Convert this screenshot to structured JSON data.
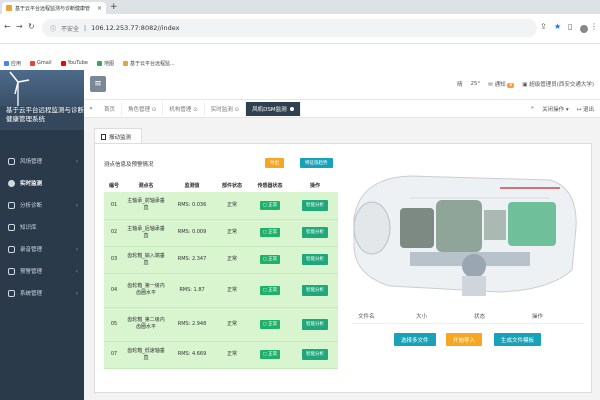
{
  "browser": {
    "tab_title": "基于云平台远程监测与诊断健康管",
    "new_tab": "+",
    "address_security": "不安全",
    "address_url": "106.12.253.77:8082//index",
    "bookmarks": [
      "应用",
      "Gmail",
      "YouTube",
      "地图",
      "基于云平台远程监..."
    ]
  },
  "sidebar": {
    "app_title": "基于云平台远程监测与诊断健康管理系统",
    "items": [
      {
        "label": "风场管理",
        "chev": "‹"
      },
      {
        "label": "实时监测",
        "chev": ""
      },
      {
        "label": "分析诊断",
        "chev": "‹"
      },
      {
        "label": "知识库",
        "chev": ""
      },
      {
        "label": "录音管理",
        "chev": "‹"
      },
      {
        "label": "预警管理",
        "chev": "‹"
      },
      {
        "label": "系统管理",
        "chev": "‹"
      }
    ]
  },
  "topbar": {
    "menu_icon": "≡",
    "weather": "晴",
    "temp": "25°",
    "notice": "通知",
    "notice_count": "8",
    "user": "超级管理员(西安交通大学)"
  },
  "tabs": {
    "items": [
      "首页",
      "角色管理 ⊙",
      "机构管理 ⊙",
      "实时监测 ⊙"
    ],
    "active": "风机DSM监测",
    "close_ops": "关闭操作 ▾",
    "exit": "退出"
  },
  "panel": {
    "tab": "振动监测",
    "table_title": "测点信息及预警情况",
    "btn_export": "导出",
    "btn_feature": "特征值趋势",
    "headers": [
      "编号",
      "测点名",
      "监测值",
      "部件状态",
      "传感器状态",
      "操作"
    ],
    "rows": [
      {
        "no": "01",
        "name": "主轴承_前轴承垂直",
        "value": "RMS: 0.036",
        "state": "正常",
        "sensor": "正常",
        "op": "智能分析"
      },
      {
        "no": "02",
        "name": "主轴承_后轴承垂直",
        "value": "RMS: 0.009",
        "state": "正常",
        "sensor": "正常",
        "op": "智能分析"
      },
      {
        "no": "03",
        "name": "齿轮箱_输入端垂直",
        "value": "RMS: 2.347",
        "state": "正常",
        "sensor": "正常",
        "op": "智能分析"
      },
      {
        "no": "04",
        "name": "齿轮箱_第一级内齿圈水平",
        "value": "RMS: 1.87",
        "state": "正常",
        "sensor": "正常",
        "op": "智能分析"
      },
      {
        "no": "05",
        "name": "齿轮箱_第二级内齿圈水平",
        "value": "RMS: 2.948",
        "state": "正常",
        "sensor": "正常",
        "op": "智能分析"
      },
      {
        "no": "07",
        "name": "齿轮箱_低速轴垂直",
        "value": "RMS: 4.669",
        "state": "正常",
        "sensor": "正常",
        "op": "智能分析"
      }
    ],
    "file_headers": [
      "文件名",
      "大小",
      "状态",
      "操作"
    ],
    "btn_select": "选择多文件",
    "btn_import": "开始导入",
    "btn_template": "生成文件模板"
  },
  "colors": {
    "sidebar": "#2b3a4a",
    "row_green": "#d8f5cf",
    "ok_green": "#1fb16a",
    "orange": "#f6a623",
    "teal": "#17a2b8"
  }
}
